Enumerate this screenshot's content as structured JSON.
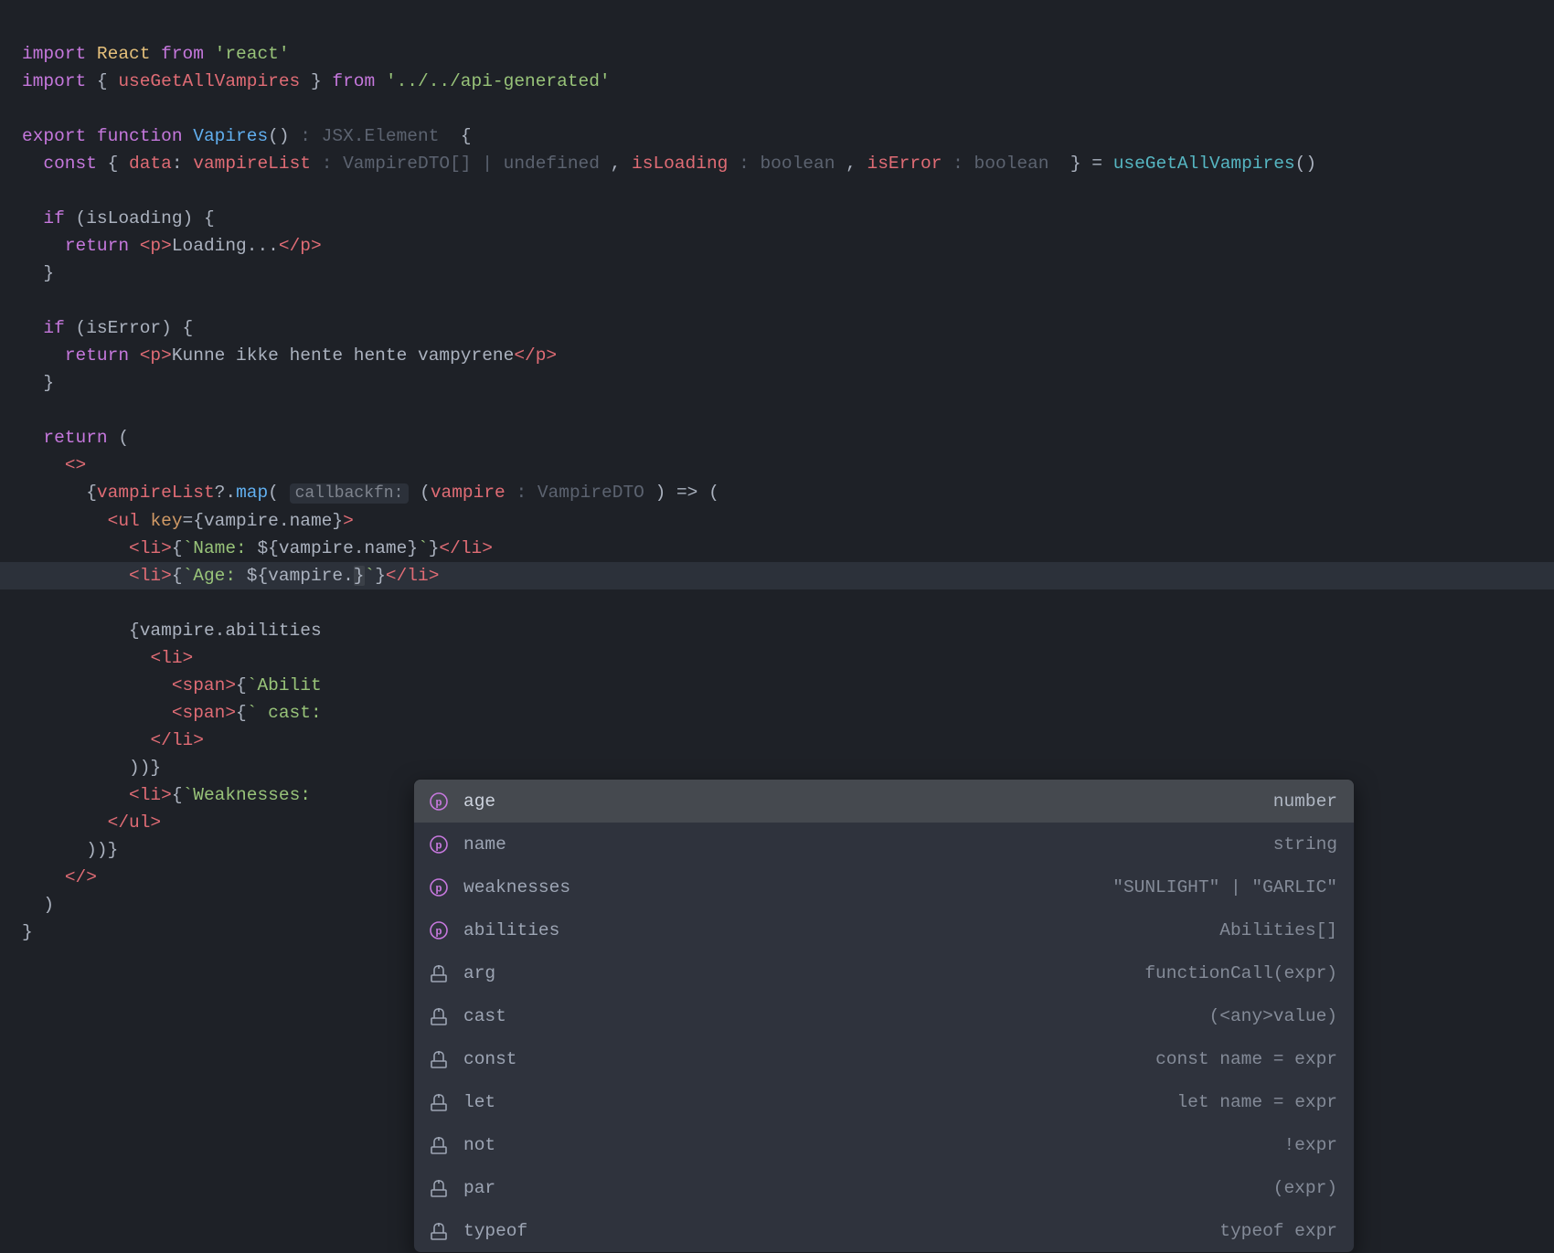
{
  "code": {
    "l1": {
      "import": "import",
      "react": "React",
      "from": "from",
      "str": "'react'"
    },
    "l2": {
      "import": "import",
      "brace_o": "{",
      "named": "useGetAllVampires",
      "brace_c": "}",
      "from": "from",
      "str": "'../../api-generated'"
    },
    "l4": {
      "export": "export",
      "function": "function",
      "fn": "Vapires",
      "parens": "()",
      "type": ": JSX.Element",
      "brace": "{"
    },
    "l5": {
      "const_": "const",
      "brace_o": "{",
      "data": "data",
      "colon": ":",
      "vampireList": "vampireList",
      "type1": ": VampireDTO[] | undefined",
      "comma1": ",",
      "isLoading": "isLoading",
      "type2": ": boolean",
      "comma2": ",",
      "isError": "isError",
      "type3": ": boolean",
      "brace_c": "}",
      "eq": "=",
      "call": "useGetAllVampires",
      "parens": "()"
    },
    "l7": {
      "if": "if",
      "cond": "(isLoading) {"
    },
    "l8": {
      "return": "return",
      "tag_o": "<p>",
      "text": "Loading...",
      "tag_c": "</p>"
    },
    "l9": {
      "brace": "}"
    },
    "l11": {
      "if": "if",
      "cond": "(isError) {"
    },
    "l12": {
      "return": "return",
      "tag_o": "<p>",
      "text": "Kunne ikke hente hente vampyrene",
      "tag_c": "</p>"
    },
    "l13": {
      "brace": "}"
    },
    "l15": {
      "return": "return",
      "paren": "("
    },
    "l16": {
      "frag": "<>"
    },
    "l17": {
      "open": "{",
      "vampireList": "vampireList",
      "opt": "?.",
      "map": "map",
      "paren_o": "(",
      "hint": "callbackfn:",
      "paren_o2": "(",
      "vampire": "vampire",
      "type": ": VampireDTO",
      "paren_c2": ")",
      "arrow": "=>",
      "paren_o3": "("
    },
    "l18": {
      "tag_o": "<ul",
      "attr": "key",
      "eq": "=",
      "brace_o": "{",
      "expr": "vampire.name",
      "brace_c": "}",
      "tag_c": ">"
    },
    "l19": {
      "tag_o": "<li>",
      "brace_o": "{",
      "tpl_o": "`",
      "tpl_text": "Name: ",
      "interp_o": "${",
      "expr": "vampire.name",
      "interp_c": "}",
      "tpl_c": "`",
      "brace_c": "}",
      "tag_c": "</li>"
    },
    "l20": {
      "tag_o": "<li>",
      "brace_o": "{",
      "tpl_o": "`",
      "tpl_text": "Age: ",
      "interp_o": "${",
      "expr": "vampire.",
      "cursor": "}",
      "interp_c": "",
      "tpl_c": "`",
      "brace_c": "}",
      "tag_c": "</li>"
    },
    "l21": {
      "open": "{",
      "expr": "vampire.abilities"
    },
    "l22": {
      "tag": "<li>"
    },
    "l23": {
      "tag_o": "<span>",
      "brace_o": "{",
      "tpl_o": "`",
      "tpl_text": "Abilit"
    },
    "l24": {
      "tag_o": "<span>",
      "brace_o": "{",
      "tpl_o": "`",
      "tpl_text": " cast:"
    },
    "l25": {
      "tag": "</li>"
    },
    "l26": {
      "close": "))}"
    },
    "l27": {
      "tag_o": "<li>",
      "brace_o": "{",
      "tpl_o": "`",
      "tpl_text": "Weaknesses:"
    },
    "l28": {
      "tag": "</ul>"
    },
    "l29": {
      "close": "))}"
    },
    "l30": {
      "frag": "</>"
    },
    "l31": {
      "paren": ")"
    },
    "l32": {
      "brace": "}"
    }
  },
  "autocomplete": {
    "items": [
      {
        "icon": "property",
        "label": "age",
        "hint": "number",
        "selected": true
      },
      {
        "icon": "property",
        "label": "name",
        "hint": "string",
        "selected": false
      },
      {
        "icon": "property",
        "label": "weaknesses",
        "hint": "\"SUNLIGHT\" | \"GARLIC\"",
        "selected": false
      },
      {
        "icon": "property",
        "label": "abilities",
        "hint": "Abilities[]",
        "selected": false
      },
      {
        "icon": "template",
        "label": "arg",
        "hint": "functionCall(expr)",
        "selected": false
      },
      {
        "icon": "template",
        "label": "cast",
        "hint": "(<any>value)",
        "selected": false
      },
      {
        "icon": "template",
        "label": "const",
        "hint": "const name = expr",
        "selected": false
      },
      {
        "icon": "template",
        "label": "let",
        "hint": "let name = expr",
        "selected": false
      },
      {
        "icon": "template",
        "label": "not",
        "hint": "!expr",
        "selected": false
      },
      {
        "icon": "template",
        "label": "par",
        "hint": "(expr)",
        "selected": false
      },
      {
        "icon": "template",
        "label": "typeof",
        "hint": "typeof expr",
        "selected": false
      }
    ]
  }
}
